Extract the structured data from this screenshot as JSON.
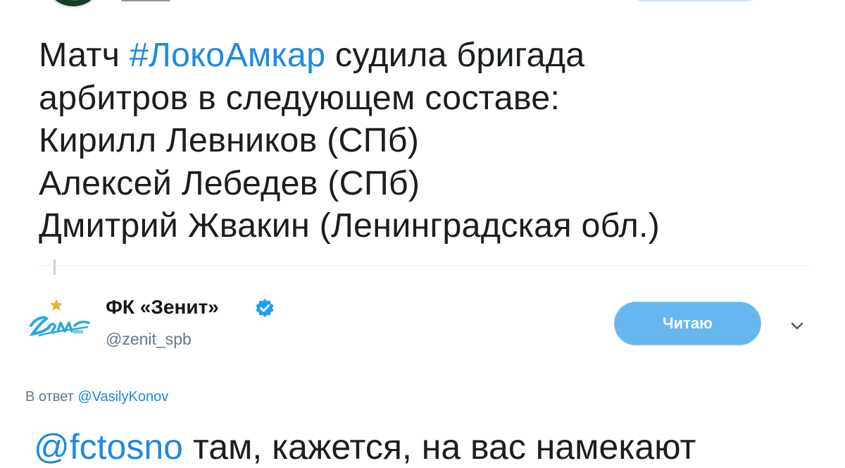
{
  "tweet": {
    "text_before_hashtag": "Матч ",
    "hashtag": "#ЛокоАмкар",
    "text_after_hashtag": " судила бригада",
    "lines": [
      "арбитров в следующем составе:",
      "Кирилл Левников (СПб)",
      "Алексей Лебедев (СПб)",
      "Дмитрий Жвакин (Ленинградская обл.)"
    ]
  },
  "reply_account": {
    "name": "ФК «Зенит»",
    "handle": "@zenit_spb",
    "follow_label": "Читаю",
    "verified": true,
    "logo_icon": "zenit-logo-icon"
  },
  "reply": {
    "reply_to_prefix": "В ответ ",
    "reply_to_user": "@VasilyKonov",
    "text_mention": "@fctosno",
    "text_rest": " там, кажется, на вас намекают"
  },
  "colors": {
    "link": "#1d8ae0",
    "follow_button": "#67b6f0",
    "secondary_text": "#657786",
    "verified_badge": "#1da1f2"
  }
}
